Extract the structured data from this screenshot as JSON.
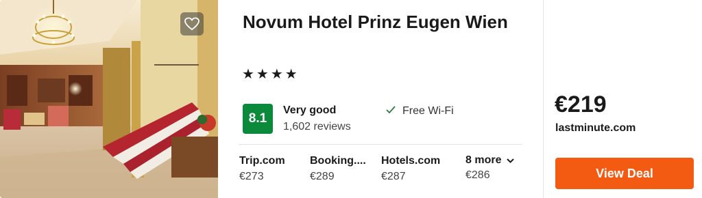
{
  "hotel": {
    "name": "Novum Hotel Prinz Eugen Wien",
    "stars": "★★★★",
    "star_count": 4,
    "rating": {
      "score": "8.1",
      "label": "Very good",
      "reviews": "1,602 reviews",
      "color": "#0a8a3a"
    },
    "amenities": [
      {
        "icon": "checkmark-icon",
        "label": "Free Wi-Fi"
      }
    ]
  },
  "other_deals": [
    {
      "site": "Trip.com",
      "price": "€273"
    },
    {
      "site": "Booking....",
      "price": "€289"
    },
    {
      "site": "Hotels.com",
      "price": "€287"
    }
  ],
  "more_deals": {
    "label": "8 more",
    "price": "€286",
    "icon": "chevron-down-icon"
  },
  "best_deal": {
    "price": "€219",
    "provider": "lastminute.com",
    "button_label": "View Deal",
    "button_color": "#f35a12"
  },
  "icons": {
    "favorite": "heart-icon"
  }
}
